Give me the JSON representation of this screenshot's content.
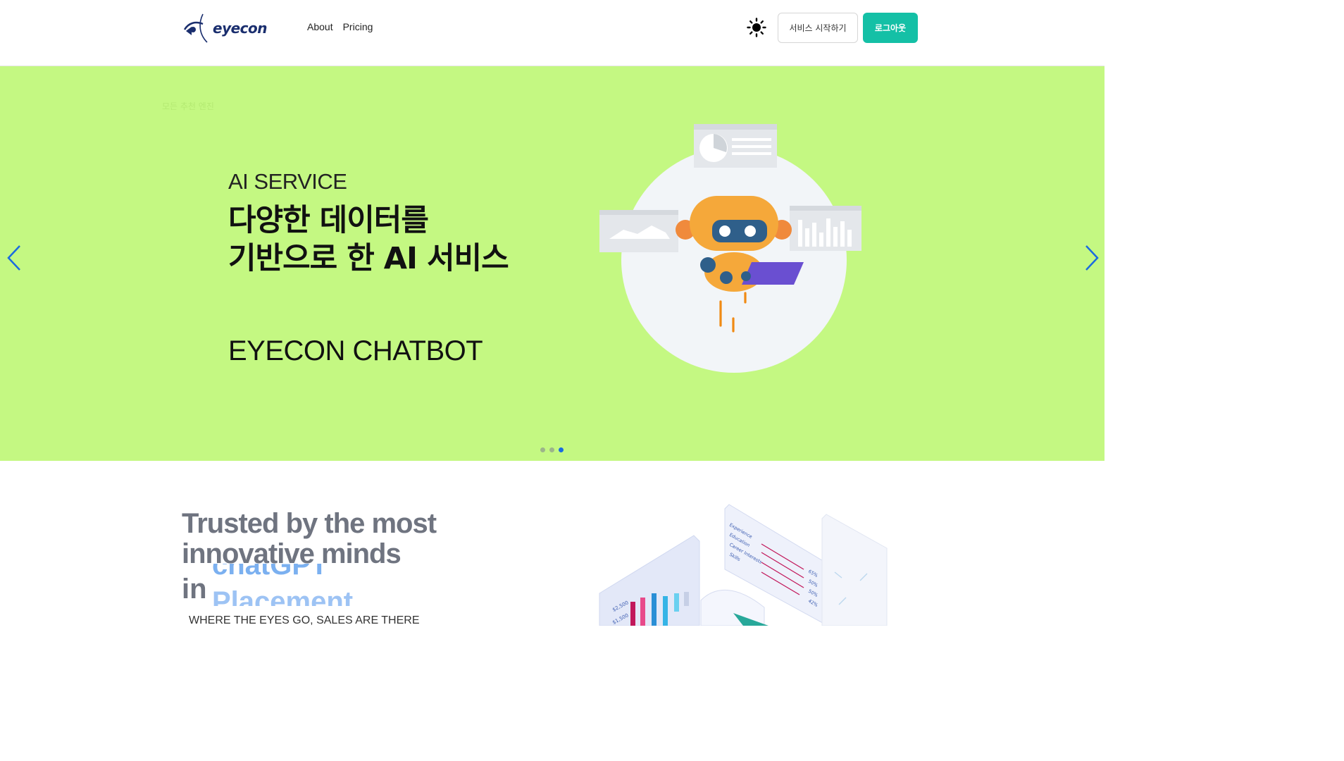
{
  "header": {
    "logo_text": "eyecon",
    "nav": [
      {
        "label": "About"
      },
      {
        "label": "Pricing"
      }
    ],
    "theme_icon": "sun-icon",
    "start_button": "서비스 시작하기",
    "logout_button": "로그아웃"
  },
  "hero": {
    "faint_text": "모든 추천 엔진",
    "kicker": "AI SERVICE",
    "title_line1": "다양한 데이터를",
    "title_line2": "기반으로 한 AI 서비스",
    "product": "EYECON CHATBOT",
    "slides_total": 3,
    "active_slide": 3,
    "prev_icon": "chevron-left-icon",
    "next_icon": "chevron-right-icon",
    "illustration": "robot-illustration",
    "colors": {
      "background": "#c4f882",
      "active_dot": "#1a6be0"
    }
  },
  "section": {
    "heading_line1": "Trusted by the most",
    "heading_line2": "innovative minds",
    "heading_prefix": "in",
    "rotating_words": [
      "chatGPT",
      "Placement"
    ],
    "tagline": "WHERE THE EYES GO, SALES ARE THERE",
    "illustration": "analytics-dashboard-illustration",
    "chart_labels": [
      "Experience",
      "Education",
      "Career Interests",
      "Skills"
    ],
    "chart_percents": [
      "65%",
      "50%",
      "50%",
      "42%"
    ],
    "chart_values": [
      "$2,500",
      "$1,500"
    ]
  },
  "colors": {
    "accent": "#14c0a6"
  }
}
